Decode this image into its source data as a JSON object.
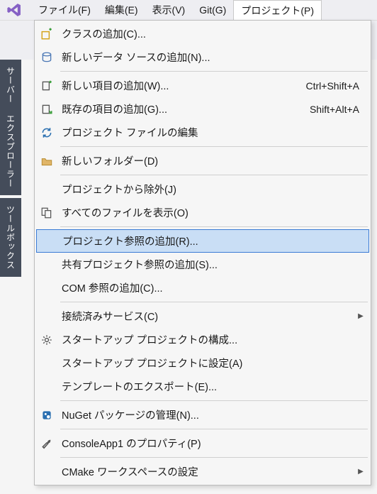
{
  "menubar": {
    "items": [
      {
        "label": "ファイル(F)"
      },
      {
        "label": "編集(E)"
      },
      {
        "label": "表示(V)"
      },
      {
        "label": "Git(G)"
      },
      {
        "label": "プロジェクト(P)"
      }
    ],
    "active_index": 4
  },
  "side_tabs": [
    {
      "label": "サーバー エクスプローラー"
    },
    {
      "label": "ツールボックス"
    }
  ],
  "dropdown": {
    "highlighted_index": 9,
    "items": [
      {
        "icon": "add-class-icon",
        "label": "クラスの追加(C)...",
        "shortcut": "",
        "submenu": false
      },
      {
        "icon": "data-source-icon",
        "label": "新しいデータ ソースの追加(N)...",
        "shortcut": "",
        "submenu": false
      },
      {
        "sep": true
      },
      {
        "icon": "new-item-icon",
        "label": "新しい項目の追加(W)...",
        "shortcut": "Ctrl+Shift+A",
        "submenu": false
      },
      {
        "icon": "existing-item-icon",
        "label": "既存の項目の追加(G)...",
        "shortcut": "Shift+Alt+A",
        "submenu": false
      },
      {
        "icon": "refresh-icon",
        "label": "プロジェクト ファイルの編集",
        "shortcut": "",
        "submenu": false
      },
      {
        "sep": true
      },
      {
        "icon": "new-folder-icon",
        "label": "新しいフォルダー(D)",
        "shortcut": "",
        "submenu": false
      },
      {
        "sep": true
      },
      {
        "icon": "",
        "label": "プロジェクトから除外(J)",
        "shortcut": "",
        "submenu": false
      },
      {
        "icon": "show-all-icon",
        "label": "すべてのファイルを表示(O)",
        "shortcut": "",
        "submenu": false
      },
      {
        "sep": true
      },
      {
        "icon": "",
        "label": "プロジェクト参照の追加(R)...",
        "shortcut": "",
        "submenu": false
      },
      {
        "icon": "",
        "label": "共有プロジェクト参照の追加(S)...",
        "shortcut": "",
        "submenu": false
      },
      {
        "icon": "",
        "label": "COM 参照の追加(C)...",
        "shortcut": "",
        "submenu": false
      },
      {
        "sep": true
      },
      {
        "icon": "",
        "label": "接続済みサービス(C)",
        "shortcut": "",
        "submenu": true
      },
      {
        "icon": "gear-icon",
        "label": "スタートアップ プロジェクトの構成...",
        "shortcut": "",
        "submenu": false
      },
      {
        "icon": "",
        "label": "スタートアップ プロジェクトに設定(A)",
        "shortcut": "",
        "submenu": false
      },
      {
        "icon": "",
        "label": "テンプレートのエクスポート(E)...",
        "shortcut": "",
        "submenu": false
      },
      {
        "sep": true
      },
      {
        "icon": "nuget-icon",
        "label": "NuGet パッケージの管理(N)...",
        "shortcut": "",
        "submenu": false
      },
      {
        "sep": true
      },
      {
        "icon": "wrench-icon",
        "label": "ConsoleApp1 のプロパティ(P)",
        "shortcut": "",
        "submenu": false
      },
      {
        "sep": true
      },
      {
        "icon": "",
        "label": "CMake ワークスペースの設定",
        "shortcut": "",
        "submenu": true
      }
    ]
  },
  "colors": {
    "highlight_bg": "#c9def5",
    "highlight_border": "#3a7bd5",
    "menu_bg": "#f6f6f6",
    "side_tab_bg": "#444c5a"
  }
}
